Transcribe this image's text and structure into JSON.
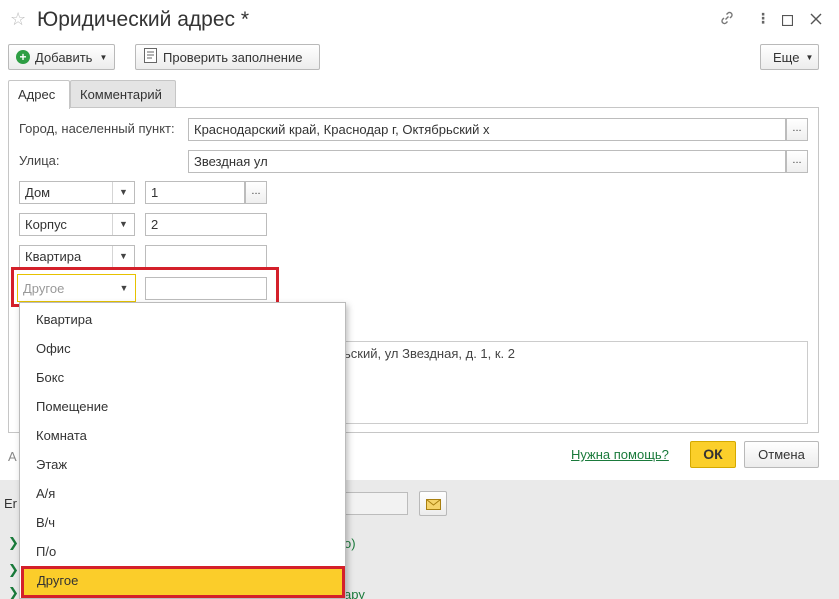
{
  "window": {
    "title": "Юридический адрес *"
  },
  "toolbar": {
    "add_label": "Добавить",
    "check_label": "Проверить заполнение",
    "more_label": "Еще"
  },
  "tabs": [
    {
      "label": "Адрес"
    },
    {
      "label": "Комментарий"
    }
  ],
  "form": {
    "city_label": "Город, населенный пункт:",
    "city_value": "Краснодарский край, Краснодар г, Октябрьский х",
    "street_label": "Улица:",
    "street_value": "Звездная ул",
    "rows": [
      {
        "type": "Дом",
        "value": "1"
      },
      {
        "type": "Корпус",
        "value": "2"
      },
      {
        "type": "Квартира",
        "value": ""
      },
      {
        "type_placeholder": "Другое",
        "value": ""
      }
    ],
    "full_address_partial": "ьский, ул Звездная, д. 1, к. 2"
  },
  "footer": {
    "help_link": "Нужна помощь?",
    "ok_label": "ОК",
    "cancel_label": "Отмена"
  },
  "dropdown": {
    "items": [
      {
        "label": "Квартира"
      },
      {
        "label": "Офис"
      },
      {
        "label": "Бокс"
      },
      {
        "label": "Помещение"
      },
      {
        "label": "Комната"
      },
      {
        "label": "Этаж"
      },
      {
        "label": "А/я"
      },
      {
        "label": "В/ч"
      },
      {
        "label": "П/о"
      },
      {
        "label": "Другое"
      }
    ],
    "selected_index": 9
  },
  "background": {
    "left_fragment_1": "А",
    "left_fragment_2": "Er",
    "green_fragment_1": "o)",
    "green_fragment_2": "ару"
  },
  "colors": {
    "accent": "#fbcd2a",
    "highlight_border": "#d4202a",
    "link": "#1a7a3b",
    "add_icon": "#2e9e44"
  }
}
